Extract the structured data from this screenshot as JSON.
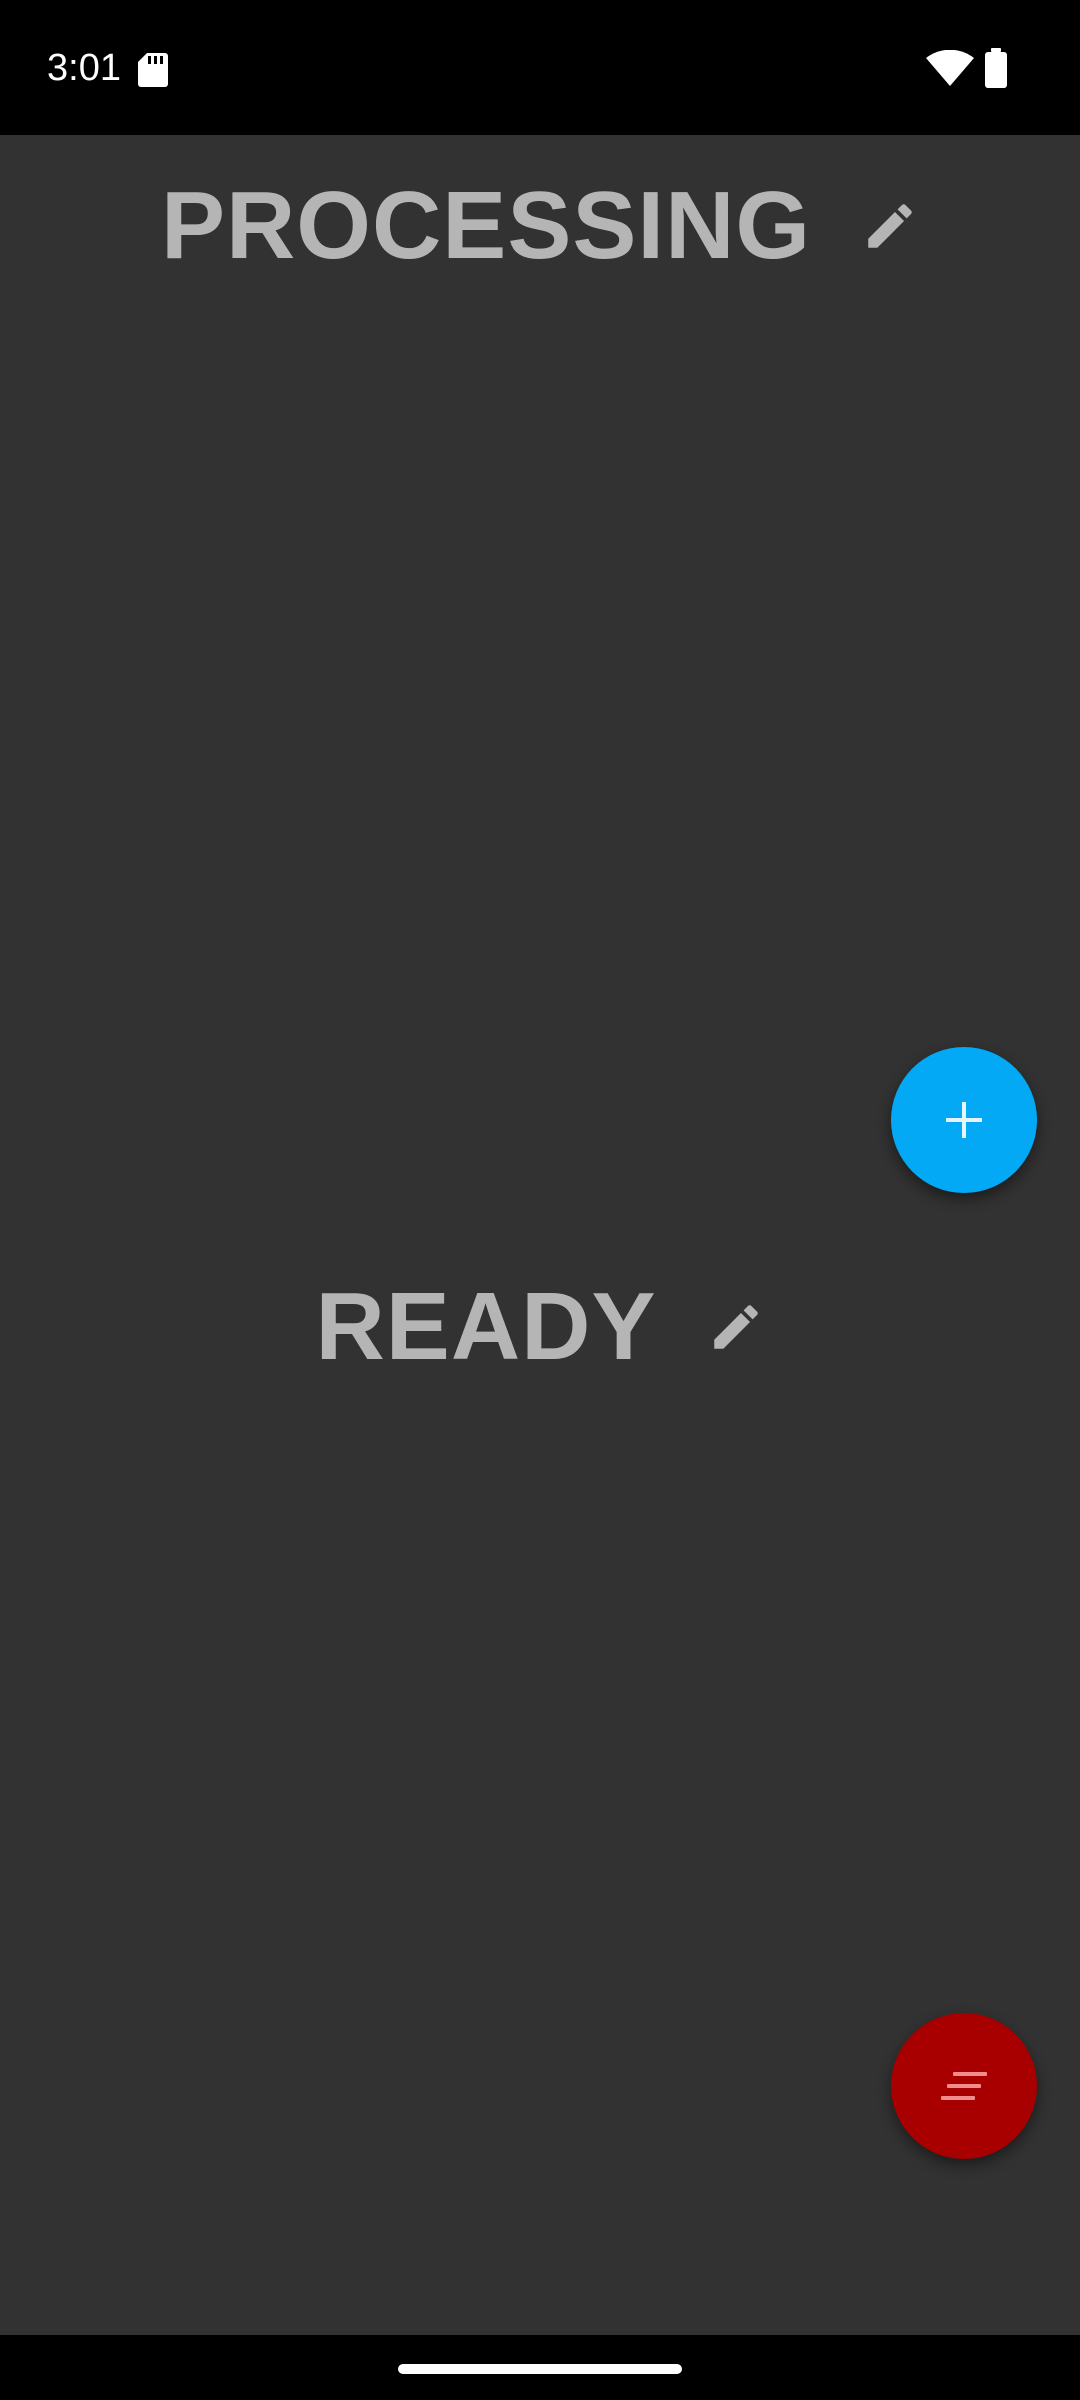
{
  "status_bar": {
    "time": "3:01",
    "icons": [
      "sd-card-icon",
      "wifi-icon",
      "battery-icon"
    ]
  },
  "columns": [
    {
      "title": "PROCESSING",
      "edit_icon": "pencil-icon"
    },
    {
      "title": "READY",
      "edit_icon": "pencil-icon"
    }
  ],
  "fabs": {
    "add": {
      "icon": "plus-icon",
      "color": "#03a9f4"
    },
    "menu": {
      "icon": "sort-lines-icon",
      "color": "#a80000"
    }
  },
  "colors": {
    "background": "#323232",
    "title_text": "#b5b5b5",
    "status_bar": "#000000"
  }
}
